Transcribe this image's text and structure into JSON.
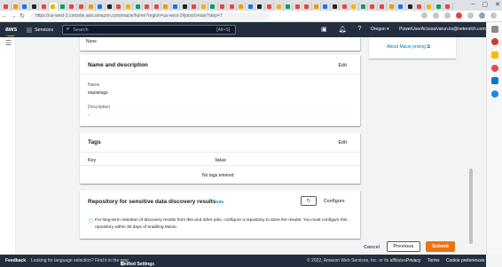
{
  "browser": {
    "url": "https://us-west-2.console.aws.amazon.com/macie/home?region=us-west-2#jobs/create?step=7",
    "tab_count": 48
  },
  "header": {
    "logo": "aws",
    "services_label": "Services",
    "search_placeholder": "Search",
    "search_shortcut": "[Alt+S]",
    "region": "Oregon ▾",
    "account": "PowerUserAccess/varun.ks@netenrich.com ▾"
  },
  "help_panel": {
    "link_text": "About Macie pricing"
  },
  "scope": {
    "value": "None"
  },
  "name_description": {
    "title": "Name and description",
    "edit_label": "Edit",
    "name_label": "Name",
    "name_value": "macielogs",
    "description_label": "Description",
    "description_value": "-"
  },
  "tags": {
    "title": "Tags",
    "edit_label": "Edit",
    "col_key": "Key",
    "col_value": "Value",
    "empty_text": "No tags entered"
  },
  "repository": {
    "title": "Repository for sensitive data discovery results",
    "info_label": "Info",
    "configure_label": "Configure",
    "alert_text": "For long-term retention of discovery results from this and other jobs, configure a repository to store the results. You must configure this repository within 30 days of enabling Macie."
  },
  "actions": {
    "cancel": "Cancel",
    "previous": "Previous",
    "submit": "Submit"
  },
  "footer": {
    "feedback": "Feedback",
    "language_prompt": "Looking for language selection? Find it in the new",
    "unified_settings": "Unified Settings",
    "copyright": "© 2022, Amazon Web Services, Inc. or its affiliates.",
    "privacy": "Privacy",
    "terms": "Terms",
    "cookie_prefs": "Cookie preferences"
  },
  "colors": {
    "aws_header": "#232f3e",
    "primary_button": "#ec7211",
    "link": "#0073bb"
  }
}
